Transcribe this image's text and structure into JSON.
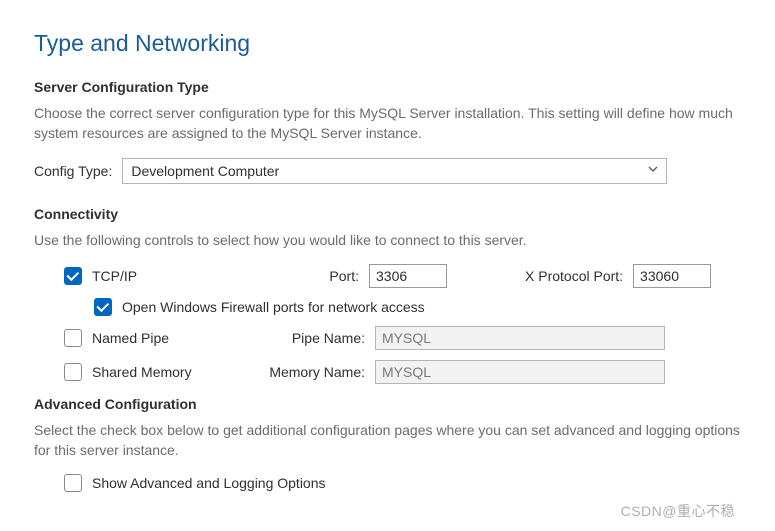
{
  "title": "Type and Networking",
  "serverConfig": {
    "heading": "Server Configuration Type",
    "desc": "Choose the correct server configuration type for this MySQL Server installation. This setting will define how much system resources are assigned to the MySQL Server instance.",
    "label": "Config Type:",
    "options": [
      "Development Computer"
    ],
    "selected": "Development Computer"
  },
  "connectivity": {
    "heading": "Connectivity",
    "desc": "Use the following controls to select how you would like to connect to this server.",
    "tcpip": {
      "label": "TCP/IP",
      "checked": true
    },
    "port": {
      "label": "Port:",
      "value": "3306"
    },
    "xport": {
      "label": "X Protocol Port:",
      "value": "33060"
    },
    "firewall": {
      "label": "Open Windows Firewall ports for network access",
      "checked": true
    },
    "namedPipe": {
      "label": "Named Pipe",
      "checked": false
    },
    "pipeName": {
      "label": "Pipe Name:",
      "value": "MYSQL"
    },
    "sharedMemory": {
      "label": "Shared Memory",
      "checked": false
    },
    "memName": {
      "label": "Memory Name:",
      "value": "MYSQL"
    }
  },
  "advanced": {
    "heading": "Advanced Configuration",
    "desc": "Select the check box below to get additional configuration pages where you can set advanced and logging options for this server instance.",
    "option": {
      "label": "Show Advanced and Logging Options",
      "checked": false
    }
  },
  "watermark": "CSDN@重心不稳"
}
